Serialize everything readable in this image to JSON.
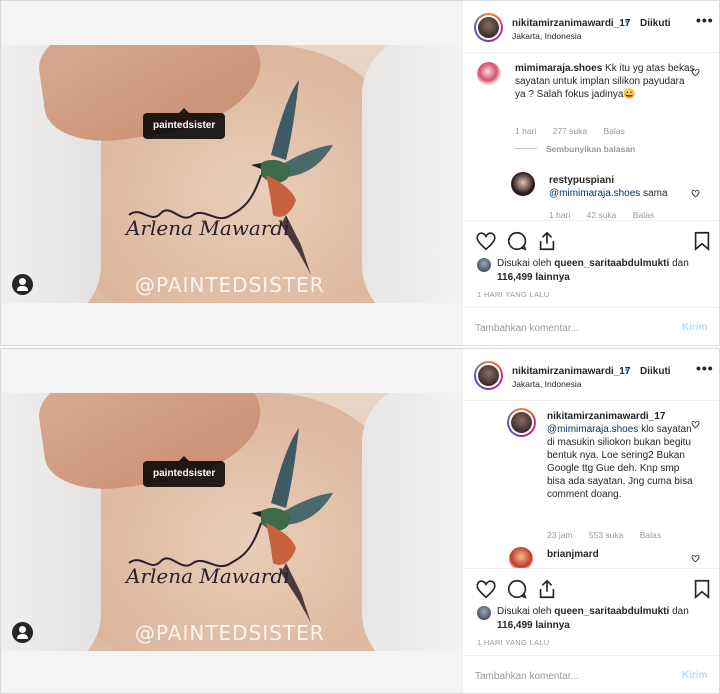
{
  "posts": [
    {
      "header": {
        "username": "nikitamirzanimawardi_17",
        "separator": "•",
        "follow_status": "Diikuti",
        "location": "Jakarta, Indonesia",
        "more_icon": "ellipsis-icon"
      },
      "photo": {
        "tag_label": "paintedsister",
        "watermark": "@PAINTEDSISTER",
        "tattoo_text": "Arlena Mawardi"
      },
      "comments": [
        {
          "username": "mimimaraja.shoes",
          "text": "Kk itu yg atas bekas sayatan untuk implan silikon payudara ya ? Salah fokus jadinya😀",
          "time": "1 hari",
          "likes": "277 suka",
          "reply": "Balas"
        },
        {
          "hide_replies": "Sembunyikan balasan"
        },
        {
          "username": "restypuspiani",
          "mention": "@mimimaraja.shoes",
          "text": " sama",
          "time": "1 hari",
          "likes": "42 suka",
          "reply": "Balas"
        }
      ],
      "likes": {
        "prefix": "Disukai oleh",
        "liker": "queen_saritaabdulmukti",
        "middle": "dan",
        "count": "116,499 lainnya"
      },
      "time_ago": "1 HARI YANG LALU",
      "comment_input_placeholder": "Tambahkan komentar...",
      "post_button": "Kirim"
    },
    {
      "header": {
        "username": "nikitamirzanimawardi_17",
        "separator": "•",
        "follow_status": "Diikuti",
        "location": "Jakarta, Indonesia",
        "more_icon": "ellipsis-icon"
      },
      "photo": {
        "tag_label": "paintedsister",
        "watermark": "@PAINTEDSISTER",
        "tattoo_text": "Arlena Mawardi"
      },
      "comments": [
        {
          "username": "nikitamirzanimawardi_17",
          "mention": "@mimimaraja.shoes",
          "text": " klo sayatan di masukin siliokon bukan begitu bentuk nya. Loe sering2 Bukan Google ttg Gue deh. Knp smp bisa ada sayatan. Jng cuma bisa comment doang.",
          "time": "23 jam",
          "likes": "553 suka",
          "reply": "Balas"
        },
        {
          "username": "brianjmard"
        }
      ],
      "likes": {
        "prefix": "Disukai oleh",
        "liker": "queen_saritaabdulmukti",
        "middle": "dan",
        "count": "116,499 lainnya"
      },
      "time_ago": "1 HARI YANG LALU",
      "comment_input_placeholder": "Tambahkan komentar...",
      "post_button": "Kirim"
    }
  ],
  "colors": {
    "link_blue": "#3897f0",
    "mention_dark_blue": "#003569",
    "muted_gray": "#999999",
    "post_button_disabled": "#b2dffc"
  }
}
